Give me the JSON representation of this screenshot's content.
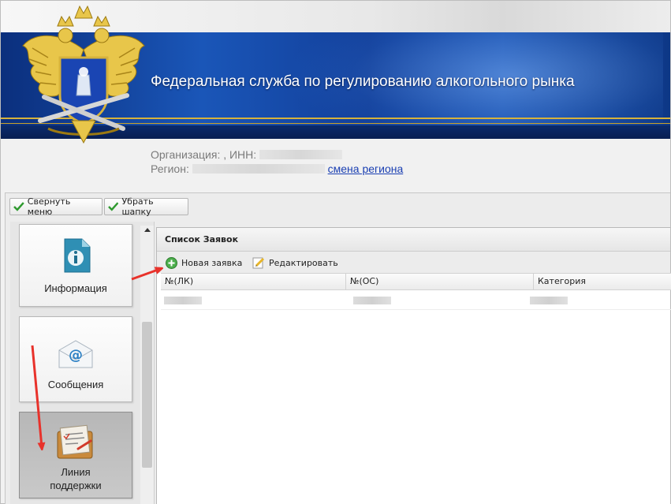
{
  "header": {
    "title": "Федеральная служба по регулированию алкогольного рынка"
  },
  "org": {
    "org_label": "Организация: , ИНН:",
    "region_label": "Регион:",
    "change_region_link": "смена региона"
  },
  "toolbar": {
    "collapse_menu_label": "Свернуть меню",
    "hide_header_label": "Убрать шапку"
  },
  "menu": {
    "items": [
      {
        "label": "Информация",
        "icon": "info-document-icon"
      },
      {
        "label": "Сообщения",
        "icon": "email-envelope-icon"
      },
      {
        "label_line1": "Линия",
        "label_line2": "поддержки",
        "icon": "support-clipboard-icon",
        "active": true
      }
    ]
  },
  "panel": {
    "title": "Список Заявок",
    "new_request_label": "Новая заявка",
    "edit_label": "Редактировать",
    "columns": [
      "№(ЛК)",
      "№(ОС)",
      "Категория"
    ]
  },
  "colors": {
    "banner_blue": "#1a56b8",
    "gold": "#d6b23c",
    "annotation_red": "#e8322b",
    "link_blue": "#1a3fb2"
  }
}
